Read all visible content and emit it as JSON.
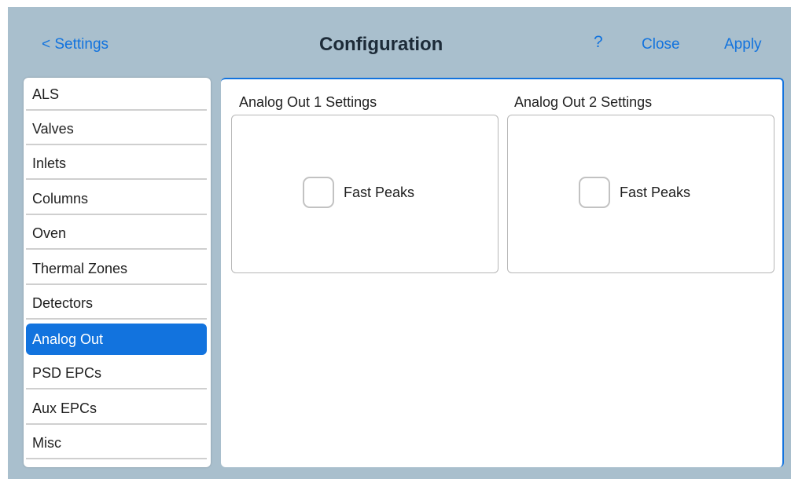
{
  "header": {
    "back_label": "< Settings",
    "title": "Configuration",
    "help_label": "?",
    "close_label": "Close",
    "apply_label": "Apply"
  },
  "sidebar": {
    "items": [
      {
        "label": "ALS"
      },
      {
        "label": "Valves"
      },
      {
        "label": "Inlets"
      },
      {
        "label": "Columns"
      },
      {
        "label": "Oven"
      },
      {
        "label": "Thermal Zones"
      },
      {
        "label": "Detectors"
      },
      {
        "label": "Analog Out",
        "active": true
      },
      {
        "label": "PSD EPCs"
      },
      {
        "label": "Aux EPCs"
      },
      {
        "label": "Misc"
      }
    ]
  },
  "main": {
    "groups": [
      {
        "title": "Analog Out 1 Settings",
        "checkbox_label": "Fast Peaks",
        "checked": false
      },
      {
        "title": "Analog Out 2 Settings",
        "checkbox_label": "Fast Peaks",
        "checked": false
      }
    ]
  },
  "colors": {
    "accent": "#1273de",
    "background": "#a9bfcd",
    "title_text": "#1d2b38"
  }
}
